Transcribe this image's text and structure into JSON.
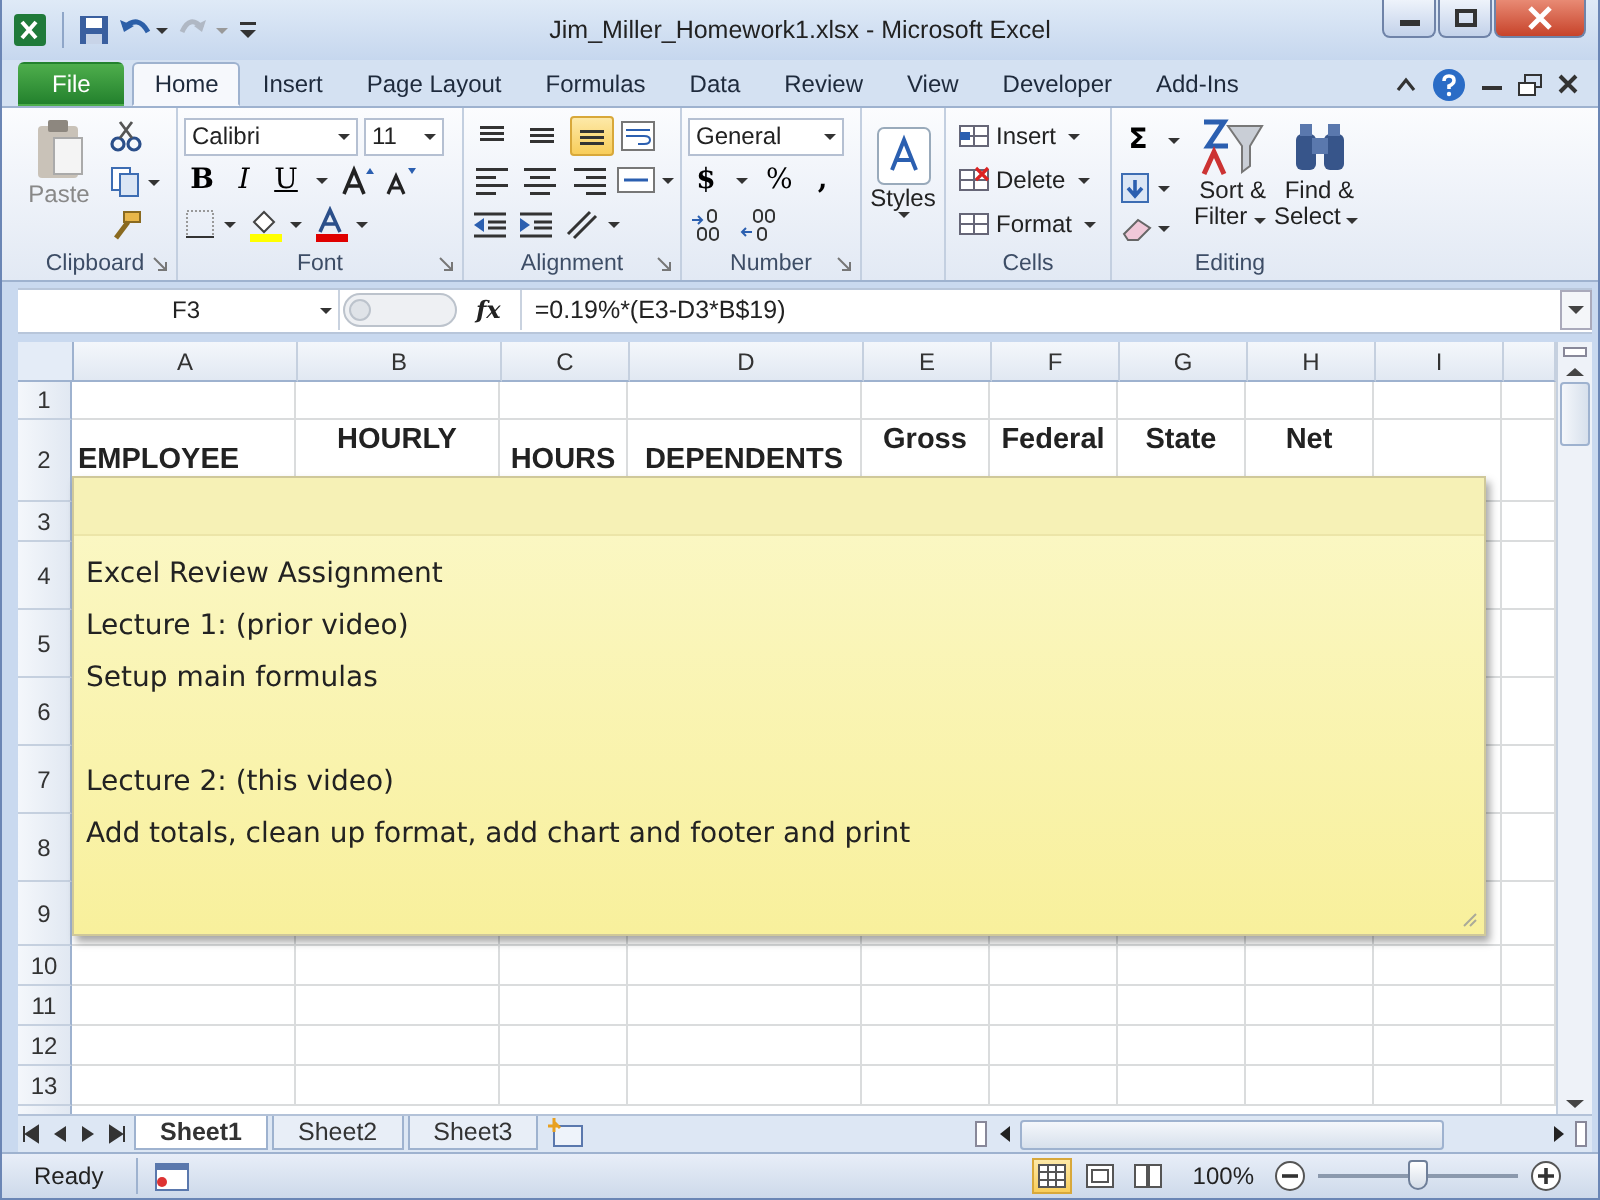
{
  "window": {
    "title": "Jim_Miller_Homework1.xlsx  -  Microsoft Excel"
  },
  "tabs": [
    {
      "label": "File",
      "kind": "file",
      "selected": false
    },
    {
      "label": "Home",
      "kind": "tab",
      "selected": true
    },
    {
      "label": "Insert",
      "kind": "tab",
      "selected": false
    },
    {
      "label": "Page Layout",
      "kind": "tab",
      "selected": false
    },
    {
      "label": "Formulas",
      "kind": "tab",
      "selected": false
    },
    {
      "label": "Data",
      "kind": "tab",
      "selected": false
    },
    {
      "label": "Review",
      "kind": "tab",
      "selected": false
    },
    {
      "label": "View",
      "kind": "tab",
      "selected": false
    },
    {
      "label": "Developer",
      "kind": "tab",
      "selected": false
    },
    {
      "label": "Add-Ins",
      "kind": "tab",
      "selected": false
    }
  ],
  "ribbon": {
    "clipboard": {
      "label": "Clipboard",
      "paste": "Paste"
    },
    "font": {
      "label": "Font",
      "font_name": "Calibri",
      "font_size": "11",
      "bold": "B",
      "italic": "I",
      "underline": "U"
    },
    "alignment": {
      "label": "Alignment",
      "vertical_align": [
        {
          "selected": false
        },
        {
          "selected": false
        },
        {
          "selected": true
        }
      ]
    },
    "number": {
      "label": "Number",
      "format": "General",
      "currency": "$",
      "percent": "%",
      "comma": ","
    },
    "styles": {
      "button": "Styles"
    },
    "cells": {
      "label": "Cells",
      "buttons": [
        "Insert",
        "Delete",
        "Format"
      ]
    },
    "editing": {
      "label": "Editing",
      "sum": "Σ",
      "sort": [
        "Sort &",
        "Filter"
      ],
      "find": [
        "Find &",
        "Select"
      ]
    }
  },
  "formula_bar": {
    "name_box": "F3",
    "function_label": "fx",
    "formula": "=0.19%*(E3-D3*B$19)"
  },
  "sheet": {
    "columns": [
      "A",
      "B",
      "C",
      "D",
      "E",
      "F",
      "G",
      "H",
      "I"
    ],
    "rows": [
      "1",
      "2",
      "3",
      "4",
      "5",
      "6",
      "7",
      "8",
      "9",
      "10",
      "11",
      "12",
      "13"
    ],
    "header_cells": [
      {
        "text": "EMPLOYEE",
        "kind": "single"
      },
      {
        "text": "HOURLY",
        "kind": "wrapped"
      },
      {
        "text": "HOURS",
        "kind": "single"
      },
      {
        "text": "DEPENDENTS",
        "kind": "single"
      },
      {
        "text": "Gross",
        "kind": "wrapped"
      },
      {
        "text": "Federal",
        "kind": "wrapped"
      },
      {
        "text": "State",
        "kind": "wrapped"
      },
      {
        "text": "Net",
        "kind": "wrapped"
      }
    ]
  },
  "note": {
    "paragraphs": [
      [
        "Excel Review Assignment",
        "Lecture 1: (prior video)",
        "Setup main formulas"
      ],
      [
        "Lecture 2: (this video)",
        "Add totals, clean up format, add chart and footer and print"
      ]
    ]
  },
  "sheet_tabs": [
    {
      "label": "Sheet1",
      "selected": true
    },
    {
      "label": "Sheet2",
      "selected": false
    },
    {
      "label": "Sheet3",
      "selected": false
    }
  ],
  "status_bar": {
    "status": "Ready",
    "views": [
      {
        "selected": true
      },
      {
        "selected": false
      },
      {
        "selected": false
      }
    ],
    "zoom": "100%",
    "zoom_slider": {
      "level": 0.5
    }
  }
}
